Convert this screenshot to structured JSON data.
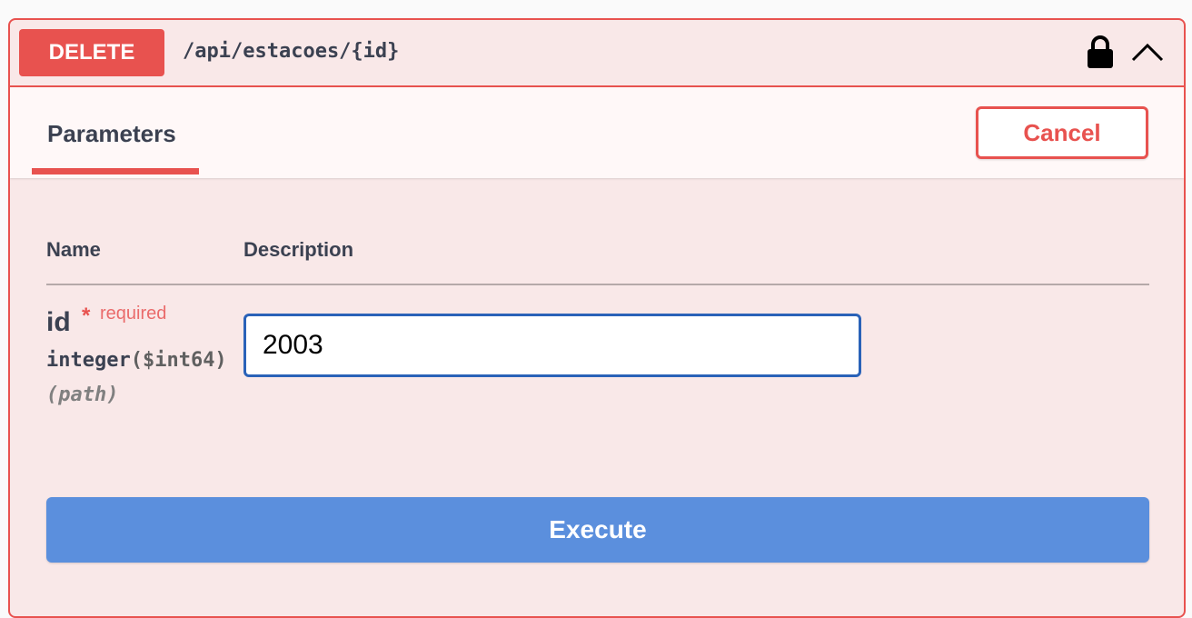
{
  "operation": {
    "method": "DELETE",
    "path": "/api/estacoes/{id}",
    "method_color": "#e8524f",
    "icons": [
      "lock-icon",
      "chevron-up-icon"
    ]
  },
  "section": {
    "tab_label": "Parameters",
    "cancel_label": "Cancel"
  },
  "table": {
    "columns": [
      "Name",
      "Description"
    ]
  },
  "parameter": {
    "name": "id",
    "required_mark": "*",
    "required_label": "required",
    "type": "integer",
    "format": "($int64)",
    "location": "(path)",
    "value": "2003"
  },
  "execute_label": "Execute",
  "colors": {
    "accent": "#e8524f",
    "background": "#f9e8e8",
    "execute": "#5b8fdd",
    "input_focus": "#2a62b8"
  }
}
